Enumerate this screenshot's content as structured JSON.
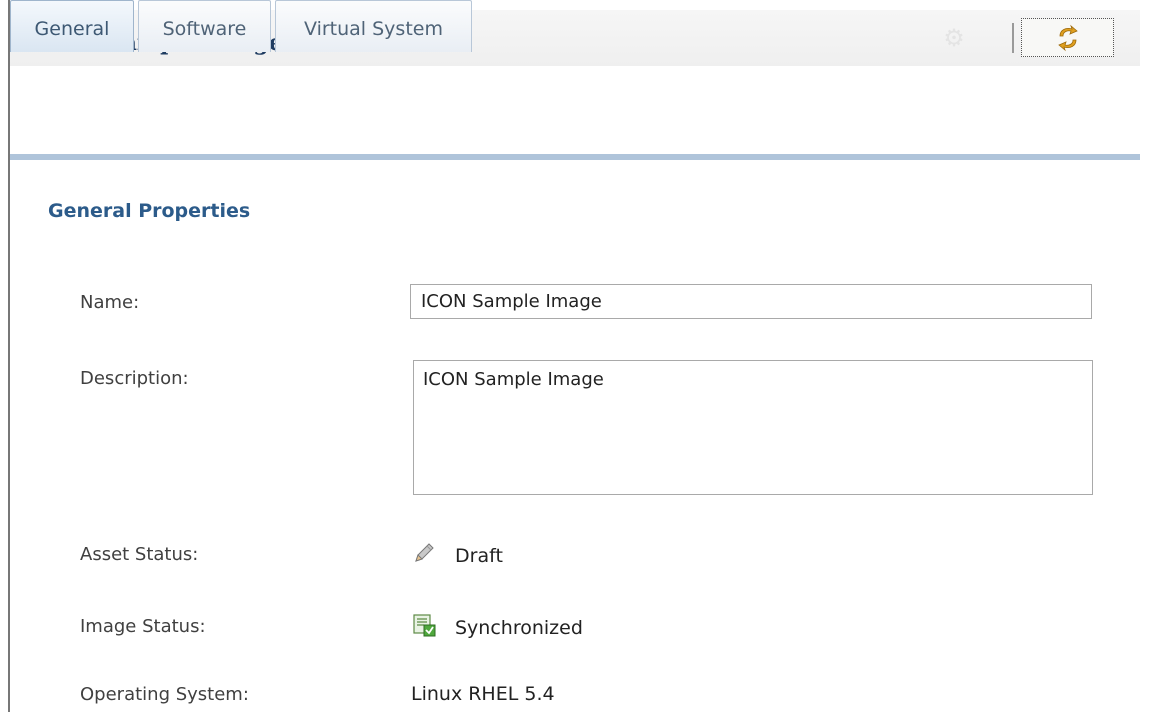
{
  "header": {
    "title": "ICON Sample Image",
    "icons": {
      "disabled": "disabled-action-icon",
      "refresh": "refresh-icon"
    }
  },
  "tabs": [
    {
      "label": "General",
      "active": true
    },
    {
      "label": "Software",
      "active": false
    },
    {
      "label": "Virtual System",
      "active": false
    }
  ],
  "section": {
    "title": "General Properties"
  },
  "form": {
    "name": {
      "label": "Name:",
      "value": "ICON Sample Image"
    },
    "description": {
      "label": "Description:",
      "value": "ICON Sample Image"
    },
    "asset_status": {
      "label": "Asset Status:",
      "value": "Draft",
      "icon": "pencil-icon"
    },
    "image_status": {
      "label": "Image Status:",
      "value": "Synchronized",
      "icon": "synchronized-icon"
    },
    "operating_system": {
      "label": "Operating System:",
      "value": "Linux RHEL 5.4"
    }
  },
  "colors": {
    "title": "#1e3b60",
    "section_title": "#2c5b8a",
    "tab_rule": "#afc4da"
  }
}
